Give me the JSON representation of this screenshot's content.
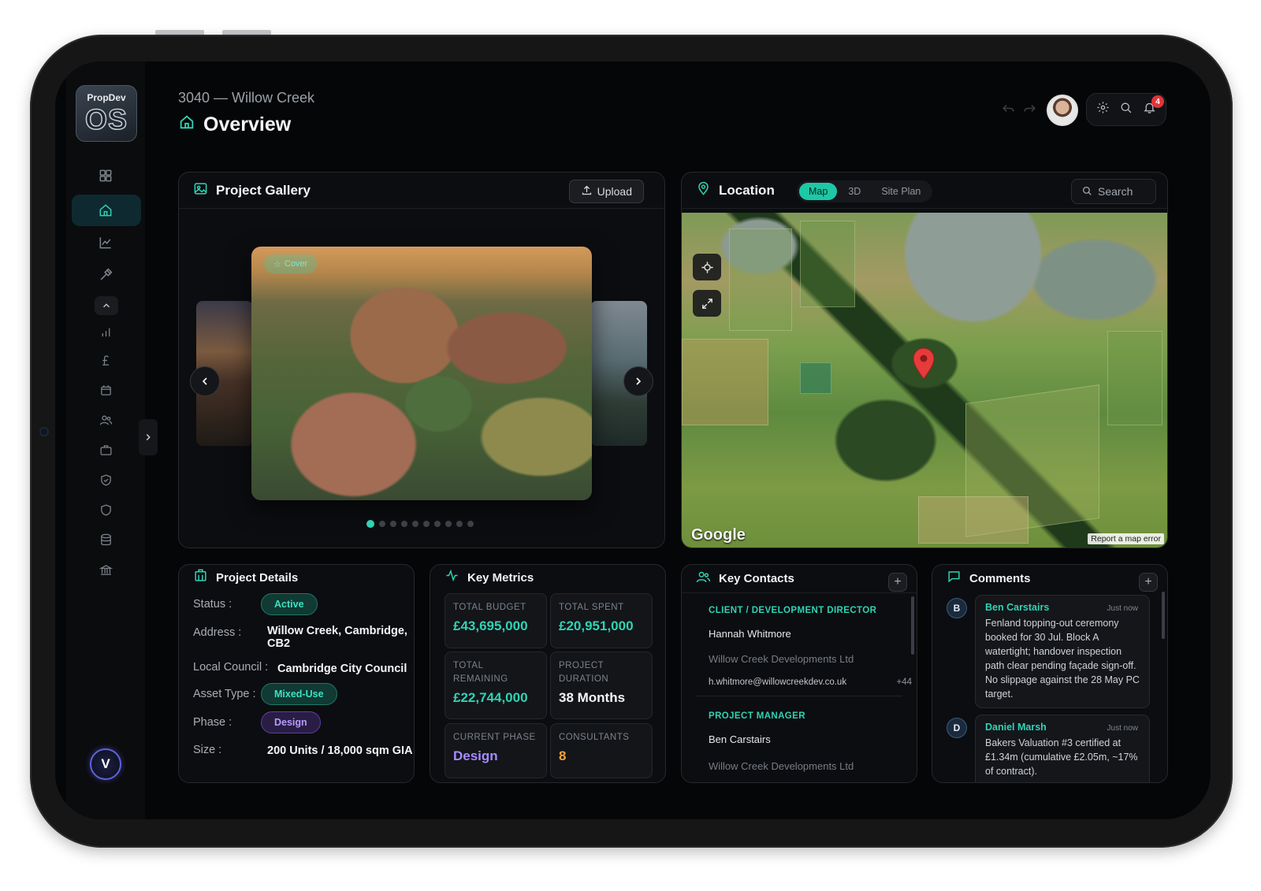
{
  "app": {
    "logo_top": "PropDev",
    "logo_main": "OS",
    "user_initial": "V"
  },
  "header": {
    "breadcrumb": "3040 — Willow Creek",
    "title": "Overview",
    "notification_count": "4"
  },
  "gallery": {
    "title": "Project Gallery",
    "upload_label": "Upload",
    "cover_label": "Cover",
    "image_count": 10,
    "active_index": 0
  },
  "location": {
    "title": "Location",
    "tabs": [
      "Map",
      "3D",
      "Site Plan"
    ],
    "active_tab": "Map",
    "search_placeholder": "Search",
    "map_brand": "Google",
    "map_error_link": "Report a map error"
  },
  "project_details": {
    "title": "Project Details",
    "status_label": "Status :",
    "status_value": "Active",
    "address_label": "Address :",
    "address_value": "Willow Creek, Cambridge, CB2",
    "council_label": "Local Council :",
    "council_value": "Cambridge City Council",
    "asset_label": "Asset Type :",
    "asset_value": "Mixed-Use",
    "phase_label": "Phase :",
    "phase_value": "Design",
    "size_label": "Size :",
    "size_value": "200 Units / 18,000 sqm GIA"
  },
  "key_metrics": {
    "title": "Key Metrics",
    "items": [
      {
        "label": "TOTAL BUDGET",
        "value": "£43,695,000"
      },
      {
        "label": "TOTAL SPENT",
        "value": "£20,951,000"
      },
      {
        "label": "TOTAL REMAINING",
        "value": "£22,744,000"
      },
      {
        "label": "PROJECT DURATION",
        "value": "38 Months"
      },
      {
        "label": "CURRENT PHASE",
        "value": "Design"
      },
      {
        "label": "CONSULTANTS",
        "value": "8"
      }
    ]
  },
  "key_contacts": {
    "title": "Key Contacts",
    "contacts": [
      {
        "role": "CLIENT / DEVELOPMENT DIRECTOR",
        "name": "Hannah Whitmore",
        "org": "Willow Creek Developments Ltd",
        "email": "h.whitmore@willowcreekdev.co.uk",
        "more": "+44"
      },
      {
        "role": "PROJECT MANAGER",
        "name": "Ben Carstairs",
        "org": "Willow Creek Developments Ltd"
      }
    ]
  },
  "comments": {
    "title": "Comments",
    "items": [
      {
        "initial": "B",
        "author": "Ben Carstairs",
        "time": "Just now",
        "text": "Fenland topping-out ceremony booked for 30 Jul. Block A watertight; handover inspection path clear pending façade sign-off. No slippage against the 28 May PC target."
      },
      {
        "initial": "D",
        "author": "Daniel Marsh",
        "time": "Just now",
        "text": "Bakers Valuation #3 certified at £1.34m (cumulative £2.05m, ~17% of contract)."
      }
    ]
  },
  "colors": {
    "accent": "#2fd3b4",
    "purple": "#a88bff",
    "orange": "#f0a43b",
    "alert": "#e0353a"
  }
}
